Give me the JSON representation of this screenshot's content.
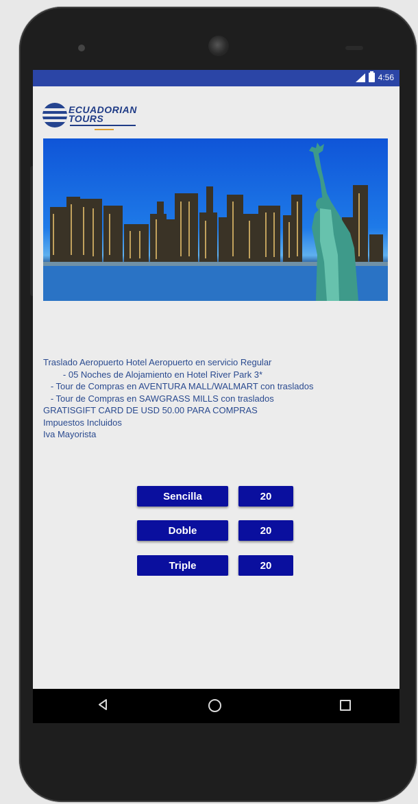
{
  "status_bar": {
    "time": "4:56"
  },
  "logo": {
    "line1": "ECUADORIAN",
    "line2": "TOURS"
  },
  "description": {
    "lines": [
      "Traslado Aeropuerto Hotel Aeropuerto en servicio Regular",
      "        - 05 Noches de Alojamiento en Hotel River Park 3*",
      "   - Tour de Compras en AVENTURA MALL/WALMART con traslados",
      "   - Tour de Compras en SAWGRASS MILLS con traslados",
      "GRATISGIFT CARD DE USD 50.00 PARA COMPRAS",
      "Impuestos Incluidos",
      "Iva Mayorista"
    ]
  },
  "rooms": [
    {
      "label": "Sencilla",
      "quantity": "20"
    },
    {
      "label": "Doble",
      "quantity": "20"
    },
    {
      "label": "Triple",
      "quantity": "20"
    }
  ],
  "colors": {
    "status_bar": "#2b45a6",
    "button": "#0a0f9e",
    "text": "#2a4a8f"
  }
}
